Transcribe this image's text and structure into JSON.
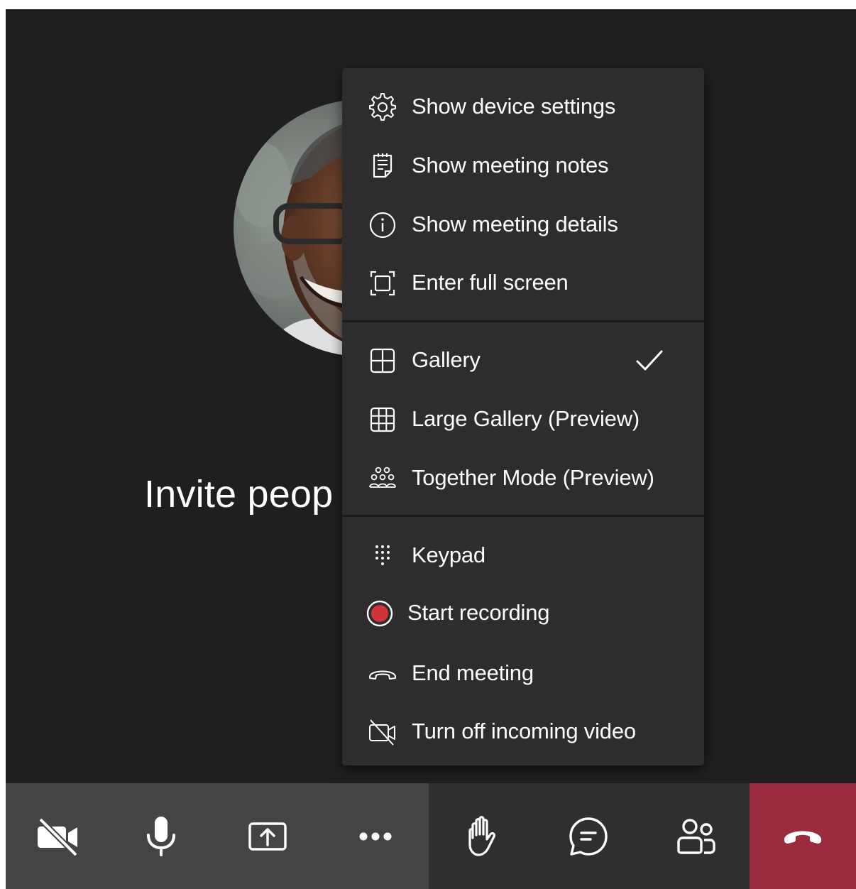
{
  "stage": {
    "invite_text": "Invite peop",
    "avatar": "participant-photo"
  },
  "menu": {
    "groups": [
      {
        "items": [
          {
            "label": "Show device settings",
            "icon": "gear-icon"
          },
          {
            "label": "Show meeting notes",
            "icon": "notes-icon"
          },
          {
            "label": "Show meeting details",
            "icon": "info-icon"
          },
          {
            "label": "Enter full screen",
            "icon": "fullscreen-icon"
          }
        ]
      },
      {
        "items": [
          {
            "label": "Gallery",
            "icon": "gallery-icon",
            "checked": true
          },
          {
            "label": "Large Gallery (Preview)",
            "icon": "large-gallery-icon"
          },
          {
            "label": "Together Mode (Preview)",
            "icon": "together-mode-icon"
          }
        ]
      },
      {
        "items": [
          {
            "label": "Keypad",
            "icon": "keypad-icon"
          },
          {
            "label": "Start recording",
            "icon": "record-icon"
          },
          {
            "label": "End meeting",
            "icon": "end-meeting-icon"
          },
          {
            "label": "Turn off incoming video",
            "icon": "video-off-icon"
          }
        ]
      }
    ]
  },
  "toolbar": {
    "buttons": [
      {
        "icon": "camera-off-icon"
      },
      {
        "icon": "microphone-icon"
      },
      {
        "icon": "share-screen-icon"
      },
      {
        "icon": "more-actions-icon"
      },
      {
        "icon": "raise-hand-icon"
      },
      {
        "icon": "chat-icon"
      },
      {
        "icon": "participants-icon"
      },
      {
        "icon": "hang-up-icon"
      }
    ]
  },
  "colors": {
    "stage_bg": "#1f1f1f",
    "menu_bg": "#2d2d2d",
    "toolbar_left_bg": "#444444",
    "toolbar_right_bg": "#2f2f2f",
    "hang_up_bg": "#9c2b3e",
    "record_red": "#d13438"
  }
}
